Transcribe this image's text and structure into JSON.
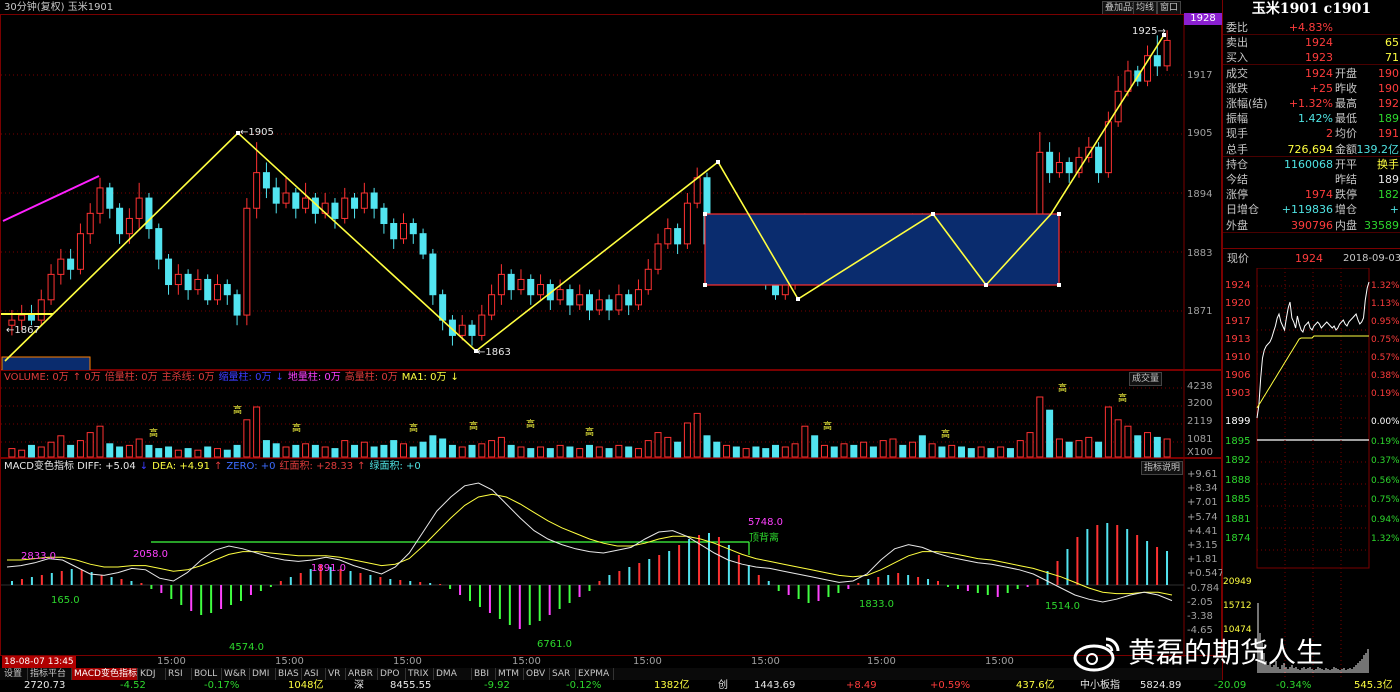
{
  "header": {
    "title": "30分钟(复权)  玉米1901",
    "buttons": [
      "叠加品种",
      "均线",
      "窗口"
    ],
    "price_badge": "1928"
  },
  "price_axis": [
    "1917",
    "1905",
    "1894",
    "1883",
    "1871"
  ],
  "price_labels": {
    "low_left": "1867",
    "high1": "1905",
    "low1": "1863",
    "high_right": "1925"
  },
  "volume": {
    "legend": [
      {
        "text": "VOLUME: 0万",
        "color": "#e03c3c"
      },
      {
        "text": "↑ 0万",
        "color": "#e03c3c"
      },
      {
        "text": "倍量柱: 0万",
        "color": "#e03c3c"
      },
      {
        "text": "主杀线: 0万",
        "color": "#e03c3c"
      },
      {
        "text": "缩量柱: 0万",
        "color": "#3c3cff"
      },
      {
        "text": "↓",
        "color": "#3c3cff"
      },
      {
        "text": "地量柱: 0万",
        "color": "#ff40ff"
      },
      {
        "text": "高量柱: 0万",
        "color": "#e03c3c"
      },
      {
        "text": "MA1: 0万",
        "color": "#ffff40"
      },
      {
        "text": "↓",
        "color": "#ffff40"
      }
    ],
    "button": "成交量",
    "axis": [
      "4238",
      "3200",
      "2119",
      "1081",
      "X100"
    ],
    "marker": "高"
  },
  "macd": {
    "legend": [
      {
        "text": "MACD变色指标 DIFF: +5.04",
        "color": "#e8e8e8"
      },
      {
        "text": "↓",
        "color": "#3c3cff"
      },
      {
        "text": "DEA: +4.91",
        "color": "#ffff40"
      },
      {
        "text": "↑",
        "color": "#e03c3c"
      },
      {
        "text": "ZERO: +0",
        "color": "#3c6cff"
      },
      {
        "text": "红面积: +28.33",
        "color": "#e03c3c"
      },
      {
        "text": "↑",
        "color": "#e03c3c"
      },
      {
        "text": "绿面积: +0",
        "color": "#4fe3e3"
      }
    ],
    "button": "指标说明",
    "axis": [
      "+9.61",
      "+8.34",
      "+7.01",
      "+5.74",
      "+4.41",
      "+3.15",
      "+1.81",
      "+0.547",
      "-0.784",
      "-2.05",
      "-3.38",
      "-4.65"
    ],
    "labels": [
      {
        "text": "2833.0",
        "color": "#ff40ff"
      },
      {
        "text": "165.0",
        "color": "#2dd72d"
      },
      {
        "text": "2058.0",
        "color": "#ff40ff"
      },
      {
        "text": "4574.0",
        "color": "#2dd72d"
      },
      {
        "text": "1891.0",
        "color": "#ff40ff"
      },
      {
        "text": "6761.0",
        "color": "#2dd72d"
      },
      {
        "text": "5748.0",
        "color": "#ff40ff"
      },
      {
        "text": "顶背离",
        "color": "#2dd72d"
      },
      {
        "text": "1833.0",
        "color": "#2dd72d"
      },
      {
        "text": "1514.0",
        "color": "#2dd72d"
      }
    ]
  },
  "time_axis": {
    "start": "18-08-07 13:45",
    "ticks": [
      "15:00",
      "15:00",
      "15:00",
      "15:00",
      "15:00",
      "15:00",
      "15:00",
      "15:00"
    ]
  },
  "tabs": [
    "设置",
    "指标平台",
    "MACD变色指标",
    "KDJ",
    "RSI",
    "BOLL",
    "W&R",
    "DMI",
    "BIAS",
    "ASI",
    "VR",
    "ARBR",
    "DPO",
    "TRIX",
    "DMA",
    "BBI",
    "MTM",
    "OBV",
    "SAR",
    "EXPMA"
  ],
  "status": [
    {
      "text": "2720.73",
      "color": "#e8e8e8"
    },
    {
      "text": "-4.52",
      "color": "#2dd72d"
    },
    {
      "text": "-0.17%",
      "color": "#2dd72d"
    },
    {
      "text": "1048亿",
      "color": "#ffff40"
    },
    {
      "text": "深",
      "color": "#e8e8e8"
    },
    {
      "text": "8455.55",
      "color": "#e8e8e8"
    },
    {
      "text": "-9.92",
      "color": "#2dd72d"
    },
    {
      "text": "-0.12%",
      "color": "#2dd72d"
    },
    {
      "text": "1382亿",
      "color": "#ffff40"
    },
    {
      "text": "创",
      "color": "#e8e8e8"
    },
    {
      "text": "1443.69",
      "color": "#e8e8e8"
    },
    {
      "text": "+8.49",
      "color": "#ff3c3c"
    },
    {
      "text": "+0.59%",
      "color": "#ff3c3c"
    },
    {
      "text": "437.6亿",
      "color": "#ffff40"
    },
    {
      "text": "中小板指",
      "color": "#e8e8e8"
    },
    {
      "text": "5824.89",
      "color": "#e8e8e8"
    },
    {
      "text": "-20.09",
      "color": "#2dd72d"
    },
    {
      "text": "-0.34%",
      "color": "#2dd72d"
    },
    {
      "text": "545.3亿",
      "color": "#ffff40"
    }
  ],
  "quote": {
    "title": "玉米1901 c1901",
    "rows": [
      {
        "l1": "委比",
        "v1": "+4.83%",
        "c1": "#ff3c3c",
        "l2": "",
        "v2": "",
        "c2": ""
      },
      {
        "l1": "卖出",
        "v1": "1924",
        "c1": "#ff3c3c",
        "l2": "",
        "v2": "65",
        "c2": "#ffff40"
      },
      {
        "l1": "买入",
        "v1": "1923",
        "c1": "#ff3c3c",
        "l2": "",
        "v2": "71",
        "c2": "#ffff40"
      },
      {
        "l1": "成交",
        "v1": "1924",
        "c1": "#ff3c3c",
        "l2": "开盘",
        "v2": "190",
        "c2": "#ff3c3c"
      },
      {
        "l1": "涨跌",
        "v1": "+25",
        "c1": "#ff3c3c",
        "l2": "昨收",
        "v2": "190",
        "c2": "#ff3c3c"
      },
      {
        "l1": "涨幅(结)",
        "v1": "+1.32%",
        "c1": "#ff3c3c",
        "l2": "最高",
        "v2": "192",
        "c2": "#ff3c3c"
      },
      {
        "l1": "振幅",
        "v1": "1.42%",
        "c1": "#4fe3e3",
        "l2": "最低",
        "v2": "189",
        "c2": "#2dd72d"
      },
      {
        "l1": "现手",
        "v1": "2",
        "c1": "#ff3c3c",
        "l2": "均价",
        "v2": "191",
        "c2": "#ff3c3c"
      },
      {
        "l1": "总手",
        "v1": "726,694",
        "c1": "#ffff40",
        "l2": "金额",
        "v2": "139.2亿",
        "c2": "#4fe3e3"
      },
      {
        "l1": "持仓",
        "v1": "1160068",
        "c1": "#4fe3e3",
        "l2": "开平",
        "v2": "换手",
        "c2": "#ffff40"
      },
      {
        "l1": "今结",
        "v1": "",
        "c1": "#e8e8e8",
        "l2": "昨结",
        "v2": "189",
        "c2": "#e8e8e8"
      },
      {
        "l1": "涨停",
        "v1": "1974",
        "c1": "#ff3c3c",
        "l2": "跌停",
        "v2": "182",
        "c2": "#2dd72d"
      },
      {
        "l1": "日增仓",
        "v1": "+119836",
        "c1": "#4fe3e3",
        "l2": "增仓",
        "v2": "+",
        "c2": "#4fe3e3"
      },
      {
        "l1": "外盘",
        "v1": "390796",
        "c1": "#ff3c3c",
        "l2": "内盘",
        "v2": "33589",
        "c2": "#2dd72d"
      }
    ],
    "current_label": "现价",
    "current_value": "1924",
    "date": "2018-09-03,-"
  },
  "mini": {
    "left_axis": [
      "1924",
      "1920",
      "1917",
      "1913",
      "1910",
      "1906",
      "1903",
      "1899",
      "1895",
      "1892",
      "1888",
      "1885",
      "1881",
      "1874"
    ],
    "right_axis": [
      "1.32%",
      "1.13%",
      "0.95%",
      "0.75%",
      "0.57%",
      "0.38%",
      "0.19%",
      "0.00%",
      "0.19%",
      "0.37%",
      "0.56%",
      "0.75%",
      "0.94%",
      "1.32%"
    ],
    "vol_axis": [
      "20949",
      "15712",
      "10474"
    ]
  },
  "watermark": "黄磊的期货人生",
  "chart_data": {
    "type": "candlestick",
    "ylim": [
      1859,
      1929
    ],
    "candles": [
      [
        1868,
        1869,
        1871,
        1866
      ],
      [
        1869,
        1870,
        1872,
        1867
      ],
      [
        1870,
        1869,
        1872,
        1868
      ],
      [
        1869,
        1873,
        1875,
        1868
      ],
      [
        1873,
        1878,
        1880,
        1872
      ],
      [
        1878,
        1881,
        1883,
        1876
      ],
      [
        1881,
        1879,
        1883,
        1877
      ],
      [
        1879,
        1886,
        1888,
        1878
      ],
      [
        1886,
        1890,
        1892,
        1884
      ],
      [
        1890,
        1895,
        1897,
        1888
      ],
      [
        1895,
        1891,
        1896,
        1889
      ],
      [
        1891,
        1886,
        1892,
        1884
      ],
      [
        1886,
        1889,
        1891,
        1884
      ],
      [
        1889,
        1893,
        1896,
        1887
      ],
      [
        1893,
        1887,
        1894,
        1885
      ],
      [
        1887,
        1881,
        1888,
        1879
      ],
      [
        1881,
        1876,
        1882,
        1874
      ],
      [
        1876,
        1878,
        1880,
        1874
      ],
      [
        1878,
        1875,
        1879,
        1873
      ],
      [
        1875,
        1877,
        1879,
        1874
      ],
      [
        1877,
        1873,
        1878,
        1872
      ],
      [
        1873,
        1876,
        1878,
        1872
      ],
      [
        1876,
        1874,
        1877,
        1872
      ],
      [
        1874,
        1870,
        1875,
        1868
      ],
      [
        1870,
        1891,
        1893,
        1868
      ],
      [
        1891,
        1898,
        1904,
        1889
      ],
      [
        1898,
        1895,
        1900,
        1893
      ],
      [
        1895,
        1892,
        1897,
        1890
      ],
      [
        1892,
        1894,
        1897,
        1891
      ],
      [
        1894,
        1891,
        1895,
        1889
      ],
      [
        1891,
        1893,
        1896,
        1890
      ],
      [
        1893,
        1890,
        1894,
        1888
      ],
      [
        1890,
        1892,
        1894,
        1889
      ],
      [
        1892,
        1889,
        1893,
        1887
      ],
      [
        1889,
        1893,
        1895,
        1888
      ],
      [
        1893,
        1891,
        1894,
        1889
      ],
      [
        1891,
        1894,
        1896,
        1890
      ],
      [
        1894,
        1891,
        1895,
        1889
      ],
      [
        1891,
        1888,
        1892,
        1886
      ],
      [
        1888,
        1885,
        1889,
        1883
      ],
      [
        1885,
        1888,
        1890,
        1884
      ],
      [
        1888,
        1886,
        1889,
        1884
      ],
      [
        1886,
        1882,
        1887,
        1881
      ],
      [
        1882,
        1874,
        1883,
        1872
      ],
      [
        1874,
        1869,
        1875,
        1867
      ],
      [
        1869,
        1866,
        1870,
        1864
      ],
      [
        1866,
        1868,
        1870,
        1865
      ],
      [
        1868,
        1866,
        1869,
        1864
      ],
      [
        1866,
        1870,
        1872,
        1865
      ],
      [
        1870,
        1874,
        1876,
        1869
      ],
      [
        1874,
        1878,
        1880,
        1872
      ],
      [
        1878,
        1875,
        1879,
        1873
      ],
      [
        1875,
        1877,
        1879,
        1874
      ],
      [
        1877,
        1874,
        1878,
        1872
      ],
      [
        1874,
        1876,
        1878,
        1873
      ],
      [
        1876,
        1873,
        1877,
        1871
      ],
      [
        1873,
        1875,
        1877,
        1872
      ],
      [
        1875,
        1872,
        1876,
        1870
      ],
      [
        1872,
        1874,
        1876,
        1871
      ],
      [
        1874,
        1871,
        1875,
        1869
      ],
      [
        1871,
        1873,
        1875,
        1870
      ],
      [
        1873,
        1871,
        1874,
        1869
      ],
      [
        1871,
        1874,
        1876,
        1870
      ],
      [
        1874,
        1872,
        1875,
        1870
      ],
      [
        1872,
        1875,
        1877,
        1871
      ],
      [
        1875,
        1879,
        1881,
        1874
      ],
      [
        1879,
        1884,
        1886,
        1878
      ],
      [
        1884,
        1887,
        1889,
        1883
      ],
      [
        1887,
        1884,
        1888,
        1882
      ],
      [
        1884,
        1892,
        1894,
        1883
      ],
      [
        1892,
        1897,
        1899,
        1891
      ],
      [
        1897,
        1884,
        1898,
        1882
      ],
      [
        1884,
        1879,
        1885,
        1877
      ],
      [
        1879,
        1881,
        1883,
        1878
      ],
      [
        1881,
        1878,
        1882,
        1876
      ],
      [
        1878,
        1880,
        1882,
        1877
      ],
      [
        1880,
        1878,
        1881,
        1876
      ],
      [
        1878,
        1876,
        1879,
        1875
      ],
      [
        1876,
        1874,
        1877,
        1873
      ],
      [
        1874,
        1876,
        1878,
        1873
      ],
      [
        1876,
        1878,
        1880,
        1875
      ],
      [
        1878,
        1888,
        1890,
        1877
      ],
      [
        1888,
        1879,
        1889,
        1877
      ],
      [
        1879,
        1881,
        1883,
        1878
      ],
      [
        1881,
        1879,
        1882,
        1877
      ],
      [
        1879,
        1882,
        1884,
        1878
      ],
      [
        1882,
        1880,
        1883,
        1878
      ],
      [
        1880,
        1883,
        1885,
        1879
      ],
      [
        1883,
        1881,
        1884,
        1879
      ],
      [
        1881,
        1885,
        1887,
        1880
      ],
      [
        1885,
        1887,
        1889,
        1884
      ],
      [
        1887,
        1885,
        1888,
        1883
      ],
      [
        1885,
        1889,
        1890,
        1884
      ],
      [
        1889,
        1881,
        1890,
        1879
      ],
      [
        1881,
        1883,
        1885,
        1880
      ],
      [
        1883,
        1880,
        1884,
        1878
      ],
      [
        1880,
        1882,
        1884,
        1879
      ],
      [
        1882,
        1879,
        1883,
        1877
      ],
      [
        1879,
        1877,
        1880,
        1876
      ],
      [
        1877,
        1879,
        1881,
        1876
      ],
      [
        1879,
        1877,
        1880,
        1876
      ],
      [
        1877,
        1879,
        1881,
        1876
      ],
      [
        1879,
        1878,
        1880,
        1876
      ],
      [
        1878,
        1883,
        1885,
        1877
      ],
      [
        1883,
        1887,
        1889,
        1882
      ],
      [
        1887,
        1902,
        1906,
        1886
      ],
      [
        1902,
        1898,
        1904,
        1896
      ],
      [
        1898,
        1900,
        1902,
        1897
      ],
      [
        1900,
        1898,
        1901,
        1896
      ],
      [
        1898,
        1901,
        1903,
        1897
      ],
      [
        1901,
        1903,
        1905,
        1900
      ],
      [
        1903,
        1898,
        1904,
        1896
      ],
      [
        1898,
        1908,
        1910,
        1897
      ],
      [
        1908,
        1914,
        1917,
        1907
      ],
      [
        1914,
        1918,
        1920,
        1913
      ],
      [
        1918,
        1916,
        1919,
        1915
      ],
      [
        1916,
        1921,
        1923,
        1915
      ],
      [
        1921,
        1919,
        1925,
        1917
      ],
      [
        1919,
        1924,
        1926,
        1918
      ]
    ]
  }
}
